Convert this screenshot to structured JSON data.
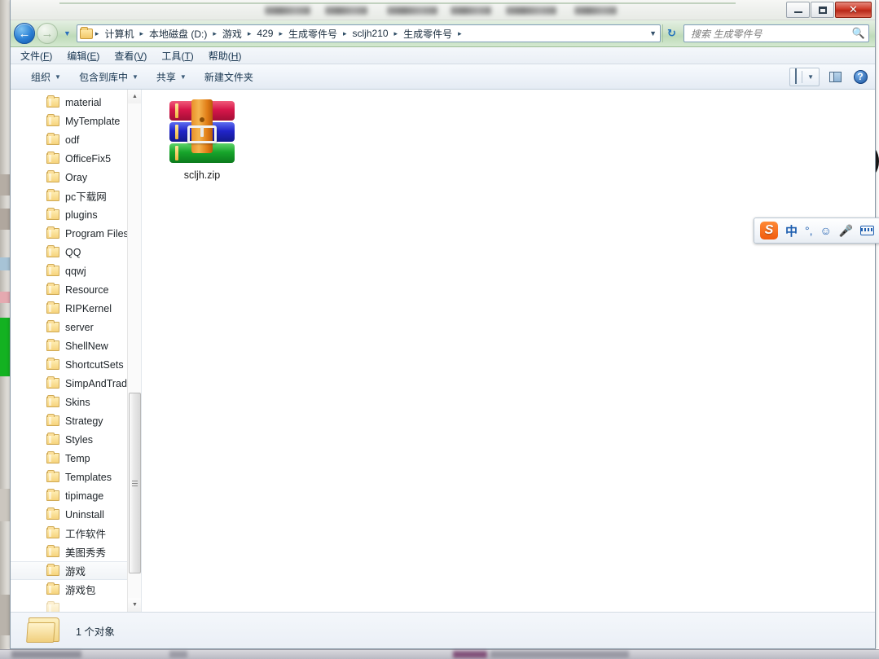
{
  "window": {
    "title_redacted": true,
    "controls": {
      "minimize": "—",
      "maximize": "❐",
      "close": "✕"
    }
  },
  "address_bar": {
    "back_label": "◀",
    "forward_label": "▶",
    "history_caret": "▼",
    "breadcrumbs": [
      "计算机",
      "本地磁盘 (D:)",
      "游戏",
      "429",
      "生成零件号",
      "scljh210",
      "生成零件号"
    ],
    "separator": "▸",
    "dropdown_caret": "▼",
    "refresh_label": "↻"
  },
  "search": {
    "placeholder": "搜索 生成零件号",
    "icon": "search-icon",
    "value": ""
  },
  "menu": {
    "items": [
      {
        "text": "文件",
        "accel": "F"
      },
      {
        "text": "编辑",
        "accel": "E"
      },
      {
        "text": "查看",
        "accel": "V"
      },
      {
        "text": "工具",
        "accel": "T"
      },
      {
        "text": "帮助",
        "accel": "H"
      }
    ]
  },
  "toolbar": {
    "items": [
      {
        "label": "组织",
        "has_caret": true
      },
      {
        "label": "包含到库中",
        "has_caret": true
      },
      {
        "label": "共享",
        "has_caret": true
      },
      {
        "label": "新建文件夹",
        "has_caret": false
      }
    ],
    "view_caret": "▼",
    "icons": [
      "view-mode-icon",
      "preview-pane-icon",
      "help-icon"
    ],
    "help_glyph": "?"
  },
  "nav_pane": {
    "items": [
      {
        "label": "material",
        "selected": false
      },
      {
        "label": "MyTemplate",
        "selected": false
      },
      {
        "label": "odf",
        "selected": false
      },
      {
        "label": "OfficeFix5",
        "selected": false
      },
      {
        "label": "Oray",
        "selected": false
      },
      {
        "label": "pc下载网",
        "selected": false
      },
      {
        "label": "plugins",
        "selected": false
      },
      {
        "label": "Program Files",
        "selected": false
      },
      {
        "label": "QQ",
        "selected": false
      },
      {
        "label": "qqwj",
        "selected": false
      },
      {
        "label": "Resource",
        "selected": false
      },
      {
        "label": "RIPKernel",
        "selected": false
      },
      {
        "label": "server",
        "selected": false
      },
      {
        "label": "ShellNew",
        "selected": false
      },
      {
        "label": "ShortcutSets",
        "selected": false
      },
      {
        "label": "SimpAndTradCo",
        "selected": false
      },
      {
        "label": "Skins",
        "selected": false
      },
      {
        "label": "Strategy",
        "selected": false
      },
      {
        "label": "Styles",
        "selected": false
      },
      {
        "label": "Temp",
        "selected": false
      },
      {
        "label": "Templates",
        "selected": false
      },
      {
        "label": "tipimage",
        "selected": false
      },
      {
        "label": "Uninstall",
        "selected": false
      },
      {
        "label": "工作软件",
        "selected": false
      },
      {
        "label": "美图秀秀",
        "selected": false
      },
      {
        "label": "游戏",
        "selected": true
      },
      {
        "label": "游戏包",
        "selected": false
      }
    ],
    "scroll_up": "▲",
    "scroll_down": "▼"
  },
  "content": {
    "files": [
      {
        "name": "scljh.zip",
        "icon": "winrar-archive-icon",
        "type": "zip"
      }
    ]
  },
  "status_bar": {
    "text": "1 个对象",
    "icon": "folder-icon"
  },
  "ime": {
    "name": "sogou-ime-toolbar",
    "logo": "S",
    "mode": "中",
    "punctuation": "°,",
    "emoji": "☺",
    "mic": "🎤",
    "keyboard": "keyboard-icon",
    "user": "user-icon"
  },
  "colors": {
    "address_bar": "#cfe3cb",
    "close_button": "#cf3a28",
    "accent_blue": "#1f5fb0",
    "sogou_orange": "#f05a0c",
    "selection": "#f1f4f7"
  }
}
